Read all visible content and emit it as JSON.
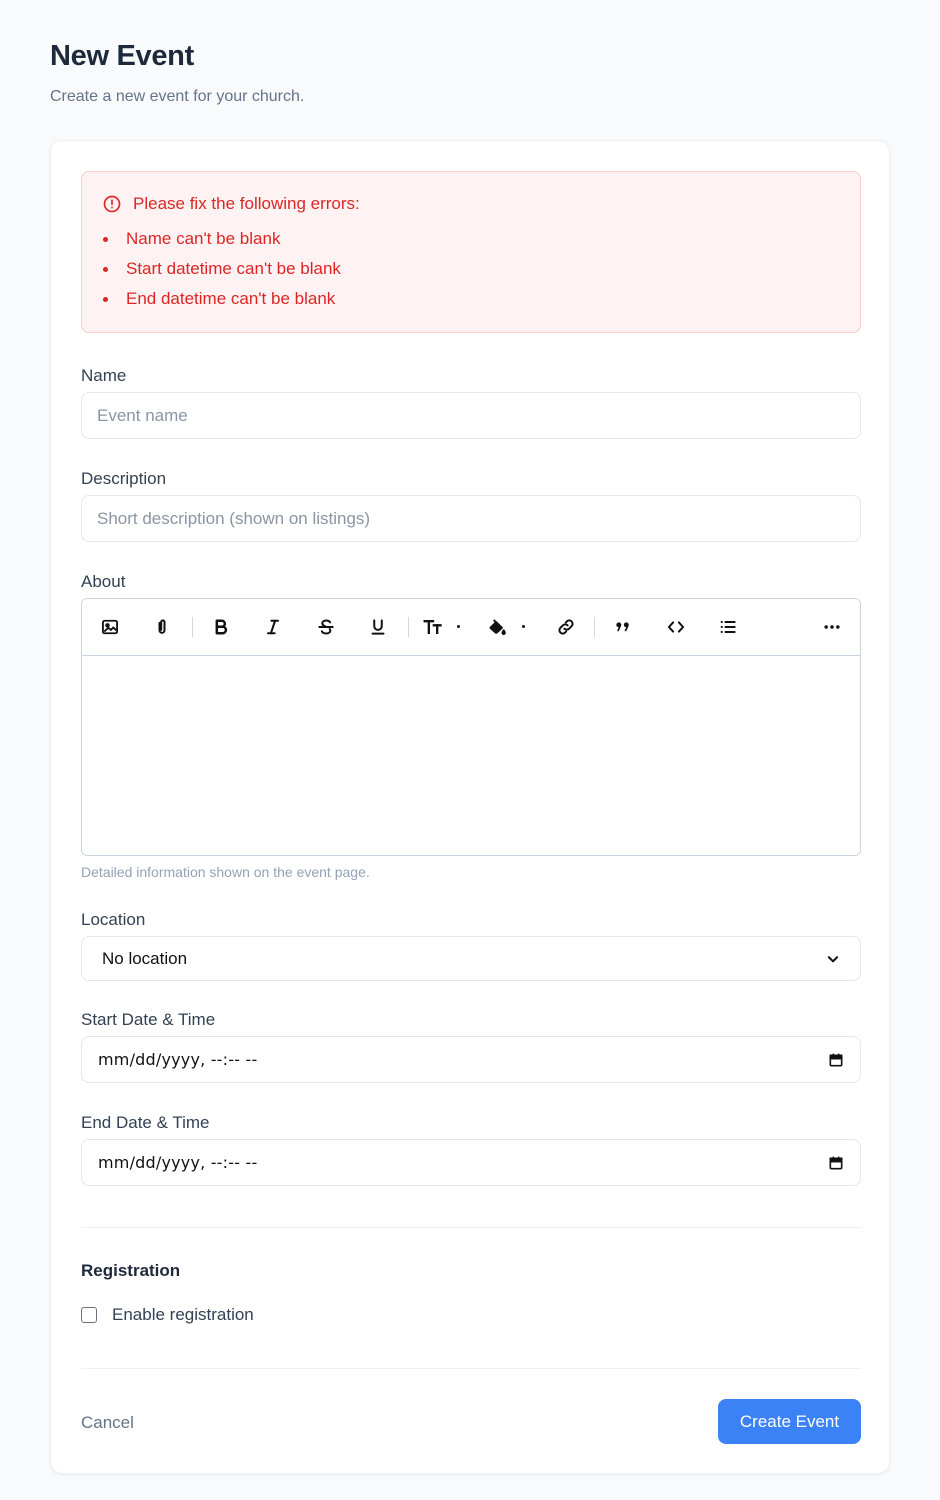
{
  "header": {
    "title": "New Event",
    "subtitle": "Create a new event for your church."
  },
  "errors": {
    "heading": "Please fix the following errors:",
    "items": [
      "Name can't be blank",
      "Start datetime can't be blank",
      "End datetime can't be blank"
    ],
    "color": "#dc2626"
  },
  "form": {
    "name": {
      "label": "Name",
      "placeholder": "Event name",
      "value": ""
    },
    "description": {
      "label": "Description",
      "placeholder": "Short description (shown on listings)",
      "value": ""
    },
    "about": {
      "label": "About",
      "hint": "Detailed information shown on the event page.",
      "toolbar": [
        "image-icon",
        "attachment-icon",
        "bold-icon",
        "italic-icon",
        "strikethrough-icon",
        "underline-icon",
        "text-size-icon",
        "text-color-icon",
        "link-icon",
        "quote-icon",
        "code-icon",
        "bullet-list-icon",
        "more-icon"
      ]
    },
    "location": {
      "label": "Location",
      "selected": "No location"
    },
    "start": {
      "label": "Start Date & Time",
      "value": "mm/dd/yyyy, --:-- --"
    },
    "end": {
      "label": "End Date & Time",
      "value": "mm/dd/yyyy, --:-- --"
    }
  },
  "registration": {
    "title": "Registration",
    "checkbox_label": "Enable registration",
    "checked": false
  },
  "actions": {
    "cancel_label": "Cancel",
    "submit_label": "Create Event",
    "accent": "#3b82f6"
  }
}
